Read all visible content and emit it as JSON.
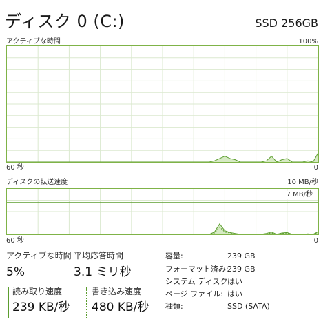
{
  "header": {
    "title": "ディスク 0 (C:)",
    "model": "SSD 256GB"
  },
  "chart_active": {
    "label_left": "アクティブな時間",
    "label_right": "100%",
    "x_left": "60 秒",
    "x_right": "0"
  },
  "chart_transfer": {
    "label_left": "ディスクの転送速度",
    "label_right": "10 MB/秒",
    "marker_label": "7 MB/秒",
    "x_left": "60 秒",
    "x_right": "0"
  },
  "stats": {
    "active_time_label": "アクティブな時間",
    "active_time_value": "5%",
    "avg_response_label": "平均応答時間",
    "avg_response_value": "3.1 ミリ秒",
    "read_label": "読み取り速度",
    "read_value": "239 KB/秒",
    "write_label": "書き込み速度",
    "write_value": "480 KB/秒"
  },
  "properties": [
    {
      "key": "容量:",
      "value": "239 GB"
    },
    {
      "key": "フォーマット済み:",
      "value": "239 GB"
    },
    {
      "key": "システム ディスク:",
      "value": "はい"
    },
    {
      "key": "ページ ファイル:",
      "value": "はい"
    },
    {
      "key": "種類:",
      "value": "SSD (SATA)"
    }
  ],
  "colors": {
    "accent": "#5c9d2f",
    "fill": "#cfe6b8",
    "grid": "#dbe9cf",
    "border": "#7fb347"
  },
  "chart_data": [
    {
      "type": "area",
      "title": "アクティブな時間",
      "x": [
        -60,
        -59,
        -58,
        -57,
        -56,
        -55,
        -54,
        -53,
        -52,
        -51,
        -50,
        -49,
        -48,
        -47,
        -46,
        -45,
        -44,
        -43,
        -42,
        -41,
        -40,
        -39,
        -38,
        -37,
        -36,
        -35,
        -34,
        -33,
        -32,
        -31,
        -30,
        -29,
        -28,
        -27,
        -26,
        -25,
        -24,
        -23,
        -22,
        -21,
        -20,
        -19,
        -18,
        -17,
        -16,
        -15,
        -14,
        -13,
        -12,
        -11,
        -10,
        -9,
        -8,
        -7,
        -6,
        -5,
        -4,
        -3,
        -2,
        -1,
        0
      ],
      "series": [
        {
          "values": [
            0,
            0,
            0,
            0,
            0,
            0,
            0,
            0,
            0,
            0,
            0,
            0,
            0,
            0,
            0,
            0,
            0,
            0,
            0,
            0,
            0,
            0,
            0,
            0,
            0,
            0,
            0,
            0,
            0,
            0,
            0,
            0,
            0,
            0,
            0,
            0,
            0,
            0,
            0,
            0,
            1,
            3,
            5,
            3,
            2,
            0,
            0,
            0,
            0,
            0,
            1,
            5,
            0,
            2,
            3,
            0,
            0,
            0,
            1,
            0,
            8
          ]
        }
      ],
      "ylim": [
        0,
        100
      ],
      "xlim": [
        -60,
        0
      ],
      "grid": true
    },
    {
      "type": "area",
      "title": "ディスクの転送速度",
      "x": [
        -60,
        -59,
        -58,
        -57,
        -56,
        -55,
        -54,
        -53,
        -52,
        -51,
        -50,
        -49,
        -48,
        -47,
        -46,
        -45,
        -44,
        -43,
        -42,
        -41,
        -40,
        -39,
        -38,
        -37,
        -36,
        -35,
        -34,
        -33,
        -32,
        -31,
        -30,
        -29,
        -28,
        -27,
        -26,
        -25,
        -24,
        -23,
        -22,
        -21,
        -20,
        -19,
        -18,
        -17,
        -16,
        -15,
        -14,
        -13,
        -12,
        -11,
        -10,
        -9,
        -8,
        -7,
        -6,
        -5,
        -4,
        -3,
        -2,
        -1,
        0
      ],
      "series": [
        {
          "name": "読み取り速度",
          "values": [
            0,
            0,
            0,
            0,
            0,
            0,
            0,
            0,
            0,
            0,
            0,
            0,
            0,
            0,
            0,
            0,
            0,
            0,
            0,
            0,
            0,
            0,
            0,
            0,
            0,
            0,
            0,
            0,
            0,
            0,
            0,
            0,
            0,
            0,
            0,
            0,
            0,
            0,
            0,
            0,
            0.5,
            2.3,
            0.8,
            0.4,
            0.2,
            0,
            0,
            0,
            0,
            0,
            0.2,
            0.5,
            0,
            0.3,
            0.4,
            0,
            0,
            0,
            0.1,
            0,
            0.6
          ]
        },
        {
          "name": "書き込み速度",
          "values": [
            0,
            0,
            0,
            0,
            0,
            0,
            0,
            0,
            0,
            0,
            0,
            0,
            0,
            0,
            0,
            0,
            0,
            0,
            0,
            0,
            0,
            0,
            0,
            0,
            0,
            0,
            0,
            0,
            0,
            0,
            0,
            0,
            0,
            0,
            0,
            0,
            0,
            0,
            0,
            0,
            0.3,
            1.6,
            0.5,
            0.3,
            0.1,
            0,
            0,
            0,
            0,
            0,
            0.1,
            0.3,
            0,
            0.2,
            0.3,
            0,
            0,
            0,
            0.1,
            0,
            0.4
          ]
        }
      ],
      "reference_line": 7,
      "ylim": [
        0,
        10
      ],
      "xlim": [
        -60,
        0
      ],
      "grid": true
    }
  ]
}
